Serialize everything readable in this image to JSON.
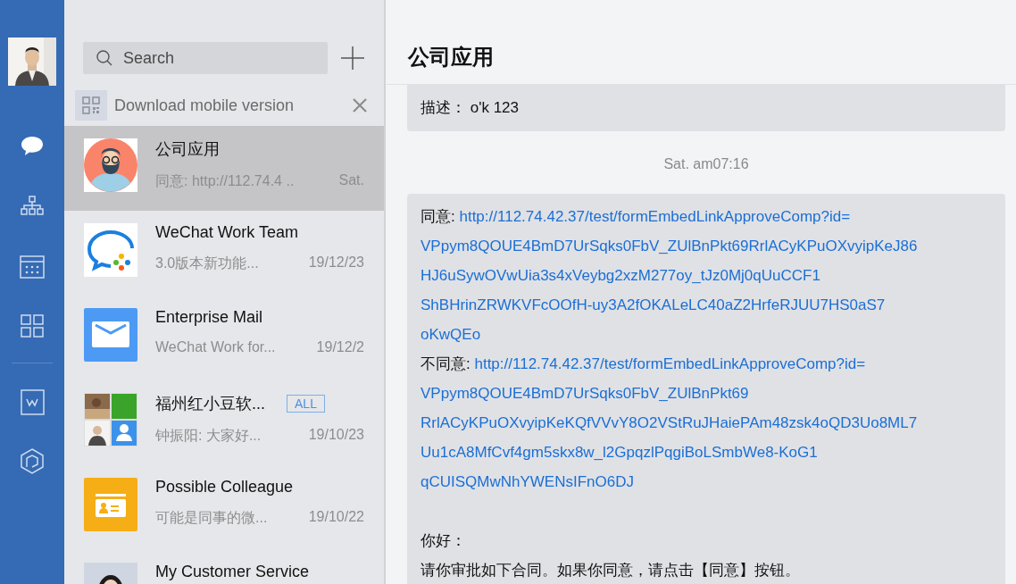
{
  "rail": {
    "items": [
      {
        "selected": true
      },
      {
        "selected": false
      },
      {
        "selected": false
      },
      {
        "selected": false
      },
      {
        "selected": false
      },
      {
        "selected": false
      }
    ]
  },
  "search": {
    "placeholder": "Search"
  },
  "banner": {
    "text": "Download mobile version"
  },
  "conversations": [
    {
      "title": "公司应用",
      "preview": "同意: http://112.74.4 ..",
      "date": "Sat.",
      "selected": true
    },
    {
      "title": "WeChat Work Team",
      "preview": "3.0版本新功能...",
      "date": "19/12/23",
      "selected": false
    },
    {
      "title": "Enterprise Mail",
      "preview": "WeChat Work for...",
      "date": "19/12/2",
      "selected": false
    },
    {
      "title": "福州红小豆软...",
      "badge": "ALL",
      "preview": "钟振阳: 大家好...",
      "date": "19/10/23",
      "selected": false
    },
    {
      "title": "Possible Colleague",
      "preview": "可能是同事的微...",
      "date": "19/10/22",
      "selected": false
    },
    {
      "title": "My Customer Service",
      "selected": false
    }
  ],
  "chat": {
    "title": "公司应用",
    "messages": [
      {
        "kind": "bubble",
        "paragraphs": [
          {
            "kind": "text",
            "text": "描述：  o'k 123"
          }
        ]
      },
      {
        "kind": "time",
        "text": "Sat. am07:16"
      },
      {
        "kind": "bubble",
        "paragraphs": [
          {
            "kind": "link",
            "label": "同意:",
            "lines": [
              "http://112.74.42.37/test/formEmbedLinkApproveComp?id=",
              "VPpym8QOUE4BmD7UrSqks0FbV_ZUlBnPkt69RrlACyKPuOXvyipKeJ86",
              "HJ6uSywOVwUia3s4xVeybg2xzM277oy_tJz0Mj0qUuCCF1",
              "ShBHrinZRWKVFcOOfH-uy3A2fOKALeLC40aZ2HrfeRJUU7HS0aS7",
              "oKwQEo"
            ]
          },
          {
            "kind": "link",
            "label": "不同意:",
            "lines": [
              "http://112.74.42.37/test/formEmbedLinkApproveComp?id=",
              "VPpym8QOUE4BmD7UrSqks0FbV_ZUlBnPkt69",
              "RrlACyKPuOXvyipKeKQfVVvY8O2VStRuJHaiePAm48zsk4oQD3Uo8ML7",
              "Uu1cA8MfCvf4gm5skx8w_l2GpqzlPqgiBoLSmbWe8-KoG1",
              "qCUISQMwNhYWENsIFnO6DJ"
            ]
          },
          {
            "kind": "text",
            "spaced": true,
            "text": "你好："
          },
          {
            "kind": "text",
            "text": "请你审批如下合同。如果你同意，请点击【同意】按钮。"
          }
        ]
      }
    ]
  }
}
